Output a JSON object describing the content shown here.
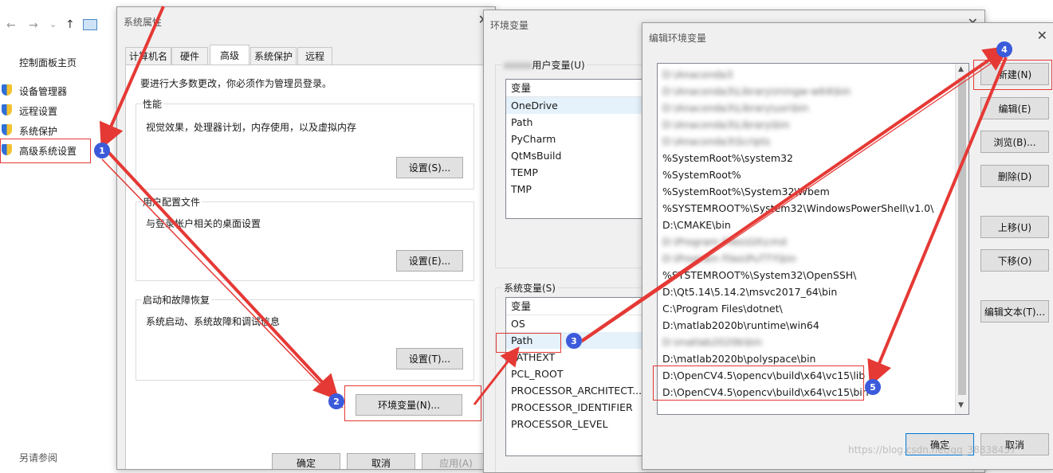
{
  "explorer": {
    "nav": [
      "←",
      "→",
      "⌄",
      "↑"
    ],
    "home_label": "控制面板主页",
    "items": [
      "设备管理器",
      "远程设置",
      "系统保护",
      "高级系统设置"
    ],
    "see_also": "另请参阅"
  },
  "sysprops": {
    "title": "系统属性",
    "tabs": [
      "计算机名",
      "硬件",
      "高级",
      "系统保护",
      "远程"
    ],
    "admin_note": "要进行大多数更改，你必须作为管理员登录。",
    "perf": {
      "label": "性能",
      "desc": "视觉效果，处理器计划，内存使用，以及虚拟内存",
      "button": "设置(S)..."
    },
    "profile": {
      "label": "用户配置文件",
      "desc": "与登录帐户相关的桌面设置",
      "button": "设置(E)..."
    },
    "startup": {
      "label": "启动和故障恢复",
      "desc": "系统启动、系统故障和调试信息",
      "button": "设置(T)..."
    },
    "env_button": "环境变量(N)...",
    "bottom_buttons": [
      "确定",
      "取消",
      "应用(A)"
    ]
  },
  "envvars": {
    "title": "环境变量",
    "user_group": "用户变量(U)",
    "user_header": "变量",
    "user_vars": [
      "OneDrive",
      "Path",
      "PyCharm",
      "QtMsBuild",
      "TEMP",
      "TMP"
    ],
    "sys_group": "系统变量(S)",
    "sys_header": "变量",
    "sys_vars": [
      "OS",
      "Path",
      "PATHEXT",
      "PCL_ROOT",
      "PROCESSOR_ARCHITECT...",
      "PROCESSOR_IDENTIFIER",
      "PROCESSOR_LEVEL"
    ]
  },
  "editenv": {
    "title": "编辑环境变量",
    "paths": [
      {
        "text": "D:\\Anaconda3",
        "blur": true
      },
      {
        "text": "D:\\Anaconda3\\Library\\mingw-w64\\bin",
        "blur": true
      },
      {
        "text": "D:\\Anaconda3\\Library\\usr\\bin",
        "blur": true
      },
      {
        "text": "D:\\Anaconda3\\Library\\bin",
        "blur": true
      },
      {
        "text": "D:\\Anaconda3\\Scripts",
        "blur": true
      },
      {
        "text": "%SystemRoot%\\system32",
        "blur": false
      },
      {
        "text": "%SystemRoot%",
        "blur": false
      },
      {
        "text": "%SystemRoot%\\System32\\Wbem",
        "blur": false
      },
      {
        "text": "%SYSTEMROOT%\\System32\\WindowsPowerShell\\v1.0\\",
        "blur": false
      },
      {
        "text": "D:\\CMAKE\\bin",
        "blur": false
      },
      {
        "text": "D:\\Program Files\\Git\\cmd",
        "blur": true
      },
      {
        "text": "D:\\Program Files\\PuTTY\\bin",
        "blur": true
      },
      {
        "text": "%SYSTEMROOT%\\System32\\OpenSSH\\",
        "blur": false
      },
      {
        "text": "D:\\Qt5.14\\5.14.2\\msvc2017_64\\bin",
        "blur": false
      },
      {
        "text": "C:\\Program Files\\dotnet\\",
        "blur": false
      },
      {
        "text": "D:\\matlab2020b\\runtime\\win64",
        "blur": false
      },
      {
        "text": "D:\\matlab2020b\\bin",
        "blur": true
      },
      {
        "text": "D:\\matlab2020b\\polyspace\\bin",
        "blur": false
      },
      {
        "text": "D:\\OpenCV4.5\\opencv\\build\\x64\\vc15\\lib",
        "blur": false
      },
      {
        "text": "D:\\OpenCV4.5\\opencv\\build\\x64\\vc15\\bin",
        "blur": false
      }
    ],
    "buttons": [
      "新建(N)",
      "编辑(E)",
      "浏览(B)...",
      "删除(D)",
      "上移(U)",
      "下移(O)",
      "编辑文本(T)..."
    ],
    "ok": "确定",
    "cancel": "取消"
  },
  "annotations": [
    "1",
    "2",
    "3",
    "4",
    "5"
  ],
  "watermark": "https://blog.csdn.net/qq_38838457",
  "colors": {
    "arrow": "#e53935",
    "badge": "#3b5bdb",
    "dialog_bg": "#f0f0f0"
  }
}
